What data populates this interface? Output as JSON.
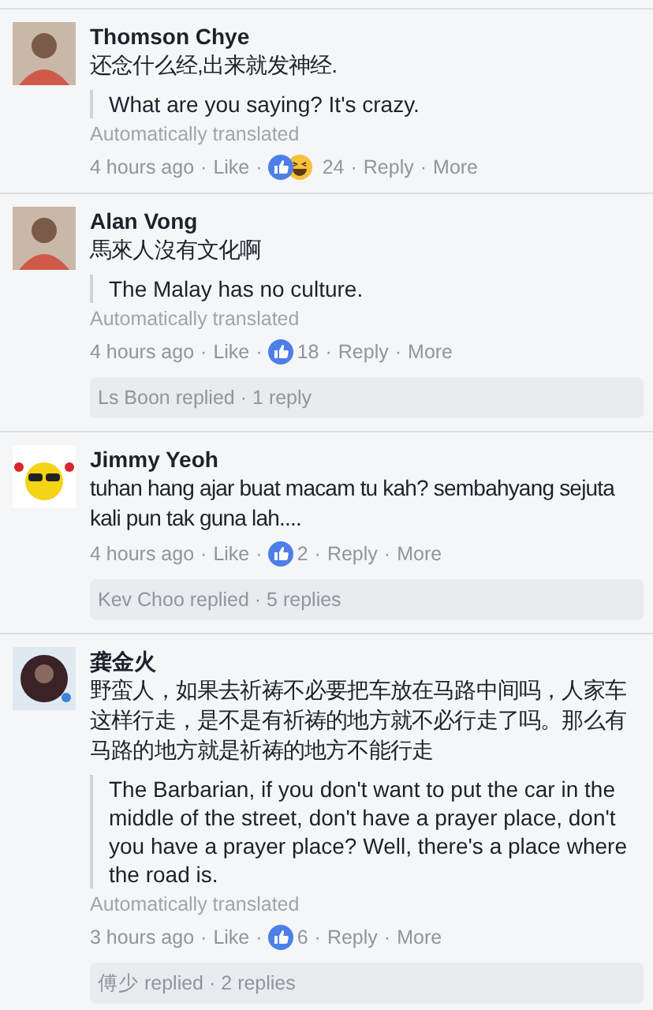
{
  "separator": "·",
  "comments": [
    {
      "author": "Thomson Chye",
      "avatar": {
        "kind": "person"
      },
      "text": "还念什么经,出来就发神经.",
      "translation": "What are you saying? It's crazy.",
      "translation_note": "Automatically translated",
      "time": "4 hours ago",
      "like": "Like",
      "reactions": [
        {
          "kind": "like"
        },
        {
          "kind": "haha"
        }
      ],
      "reaction_count": "24",
      "reply": "Reply",
      "more": "More"
    },
    {
      "author": "Alan Vong",
      "avatar": {
        "kind": "person"
      },
      "text": "馬來人沒有文化啊",
      "translation": "The Malay has no culture.",
      "translation_note": "Automatically translated",
      "time": "4 hours ago",
      "like": "Like",
      "reactions": [
        {
          "kind": "like"
        }
      ],
      "reaction_count": "18",
      "reply": "Reply",
      "more": "More",
      "replies": {
        "who": "Ls Boon replied",
        "count": "1 reply"
      }
    },
    {
      "author": "Jimmy Yeoh",
      "avatar": {
        "kind": "smiley"
      },
      "text": "tuhan hang ajar buat macam tu kah? sembahyang sejuta kali pun tak guna lah....",
      "time": "4 hours ago",
      "like": "Like",
      "reactions": [
        {
          "kind": "like"
        }
      ],
      "reaction_count": "2",
      "reply": "Reply",
      "more": "More",
      "replies": {
        "who": "Kev Choo replied",
        "count": "5 replies"
      }
    },
    {
      "author": "龚金火",
      "avatar": {
        "kind": "round"
      },
      "text": "野蛮人，如果去祈祷不必要把车放在马路中间吗，人家车这样行走，是不是有祈祷的地方就不必行走了吗。那么有马路的地方就是祈祷的地方不能行走",
      "translation": "The Barbarian, if you don't want to put the car in the middle of the street, don't have a prayer place, don't you have a prayer place? Well, there's a place where the road is.",
      "translation_note": "Automatically translated",
      "time": "3 hours ago",
      "like": "Like",
      "reactions": [
        {
          "kind": "like"
        }
      ],
      "reaction_count": "6",
      "reply": "Reply",
      "more": "More",
      "replies": {
        "who": "傅少 replied",
        "count": "2 replies"
      }
    }
  ]
}
